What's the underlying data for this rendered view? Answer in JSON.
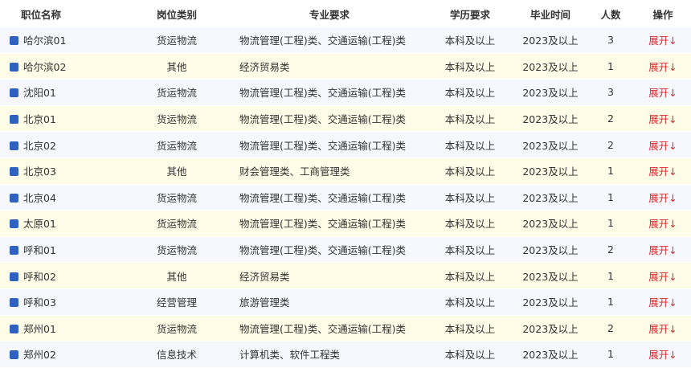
{
  "columns": [
    "职位名称",
    "岗位类别",
    "专业要求",
    "学历要求",
    "毕业时间",
    "人数",
    "操作"
  ],
  "rows": [
    {
      "name": "哈尔滨01",
      "category": "货运物流",
      "major": "物流管理(工程)类、交通运输(工程)类",
      "education": "本科及以上",
      "grad": "2023及以上",
      "count": "3",
      "action": "展开↓"
    },
    {
      "name": "哈尔滨02",
      "category": "其他",
      "major": "经济贸易类",
      "education": "本科及以上",
      "grad": "2023及以上",
      "count": "1",
      "action": "展开↓"
    },
    {
      "name": "沈阳01",
      "category": "货运物流",
      "major": "物流管理(工程)类、交通运输(工程)类",
      "education": "本科及以上",
      "grad": "2023及以上",
      "count": "3",
      "action": "展开↓"
    },
    {
      "name": "北京01",
      "category": "货运物流",
      "major": "物流管理(工程)类、交通运输(工程)类",
      "education": "本科及以上",
      "grad": "2023及以上",
      "count": "2",
      "action": "展开↓"
    },
    {
      "name": "北京02",
      "category": "货运物流",
      "major": "物流管理(工程)类、交通运输(工程)类",
      "education": "本科及以上",
      "grad": "2023及以上",
      "count": "2",
      "action": "展开↓"
    },
    {
      "name": "北京03",
      "category": "其他",
      "major": "财会管理类、工商管理类",
      "education": "本科及以上",
      "grad": "2023及以上",
      "count": "1",
      "action": "展开↓"
    },
    {
      "name": "北京04",
      "category": "货运物流",
      "major": "物流管理(工程)类、交通运输(工程)类",
      "education": "本科及以上",
      "grad": "2023及以上",
      "count": "1",
      "action": "展开↓"
    },
    {
      "name": "太原01",
      "category": "货运物流",
      "major": "物流管理(工程)类、交通运输(工程)类",
      "education": "本科及以上",
      "grad": "2023及以上",
      "count": "1",
      "action": "展开↓"
    },
    {
      "name": "呼和01",
      "category": "货运物流",
      "major": "物流管理(工程)类、交通运输(工程)类",
      "education": "本科及以上",
      "grad": "2023及以上",
      "count": "2",
      "action": "展开↓"
    },
    {
      "name": "呼和02",
      "category": "其他",
      "major": "经济贸易类",
      "education": "本科及以上",
      "grad": "2023及以上",
      "count": "1",
      "action": "展开↓"
    },
    {
      "name": "呼和03",
      "category": "经营管理",
      "major": "旅游管理类",
      "education": "本科及以上",
      "grad": "2023及以上",
      "count": "1",
      "action": "展开↓"
    },
    {
      "name": "郑州01",
      "category": "货运物流",
      "major": "物流管理(工程)类、交通运输(工程)类",
      "education": "本科及以上",
      "grad": "2023及以上",
      "count": "2",
      "action": "展开↓"
    },
    {
      "name": "郑州02",
      "category": "信息技术",
      "major": "计算机类、软件工程类",
      "education": "本科及以上",
      "grad": "2023及以上",
      "count": "1",
      "action": "展开↓"
    }
  ],
  "colors": {
    "marker": "#2f62c0",
    "action": "#e0262b",
    "row_odd": "#f7f8fd",
    "row_even": "#fffde7"
  }
}
